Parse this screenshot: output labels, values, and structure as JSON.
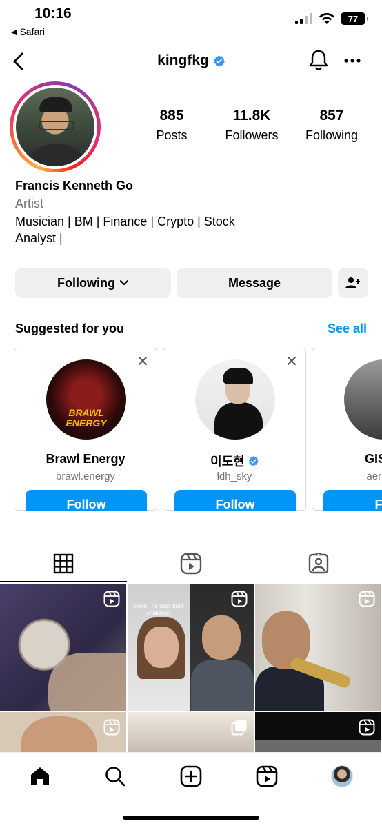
{
  "status_bar": {
    "time": "10:16",
    "back_app": "Safari",
    "battery": "77"
  },
  "header": {
    "username": "kingfkg",
    "verified": true
  },
  "profile": {
    "stats": [
      {
        "value": "885",
        "label": "Posts"
      },
      {
        "value": "11.8K",
        "label": "Followers"
      },
      {
        "value": "857",
        "label": "Following"
      }
    ],
    "name": "Francis Kenneth Go",
    "category": "Artist",
    "bio_line1": "Musician | BM | Finance | Crypto | Stock",
    "bio_line2": "Analyst |"
  },
  "actions": {
    "following_label": "Following",
    "message_label": "Message"
  },
  "suggested": {
    "title": "Suggested for you",
    "see_all": "See all",
    "cards": [
      {
        "name": "Brawl Energy",
        "handle": "brawl.energy",
        "follow": "Follow",
        "verified": false,
        "logo_text": "BRAWL ENERGY"
      },
      {
        "name": "이도현",
        "handle": "ldh_sky",
        "follow": "Follow",
        "verified": true
      },
      {
        "name": "GISEL",
        "handle": "aericha",
        "follow": "Fol",
        "verified": false
      }
    ]
  },
  "grid": {
    "tile2_caption": "From The Start duet challenge"
  },
  "icons": {
    "back": "chevron-left-icon",
    "bell": "bell-icon",
    "more": "more-horizontal-icon",
    "grid": "grid-icon",
    "reels": "reels-icon",
    "tagged": "tagged-icon",
    "home": "home-icon",
    "search": "search-icon",
    "create": "plus-square-icon",
    "profile": "avatar"
  },
  "colors": {
    "accent": "#0095f6",
    "button_bg": "#efefef",
    "secondary_text": "#737373"
  }
}
